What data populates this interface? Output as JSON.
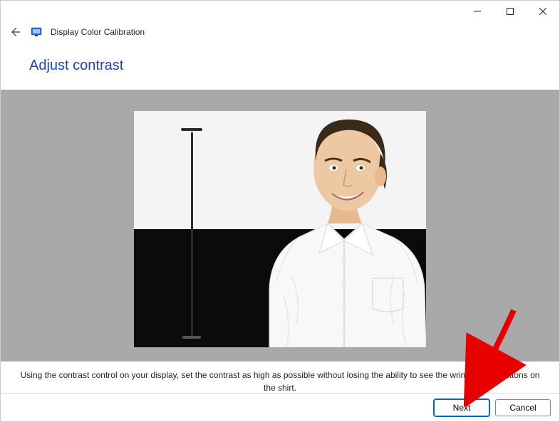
{
  "window": {
    "app_title": "Display Color Calibration"
  },
  "page": {
    "heading": "Adjust contrast",
    "instruction": "Using the contrast control on your display, set the contrast as high as possible without losing the ability to see the wrinkles and buttons on the shirt."
  },
  "buttons": {
    "next": "Next",
    "cancel": "Cancel"
  }
}
